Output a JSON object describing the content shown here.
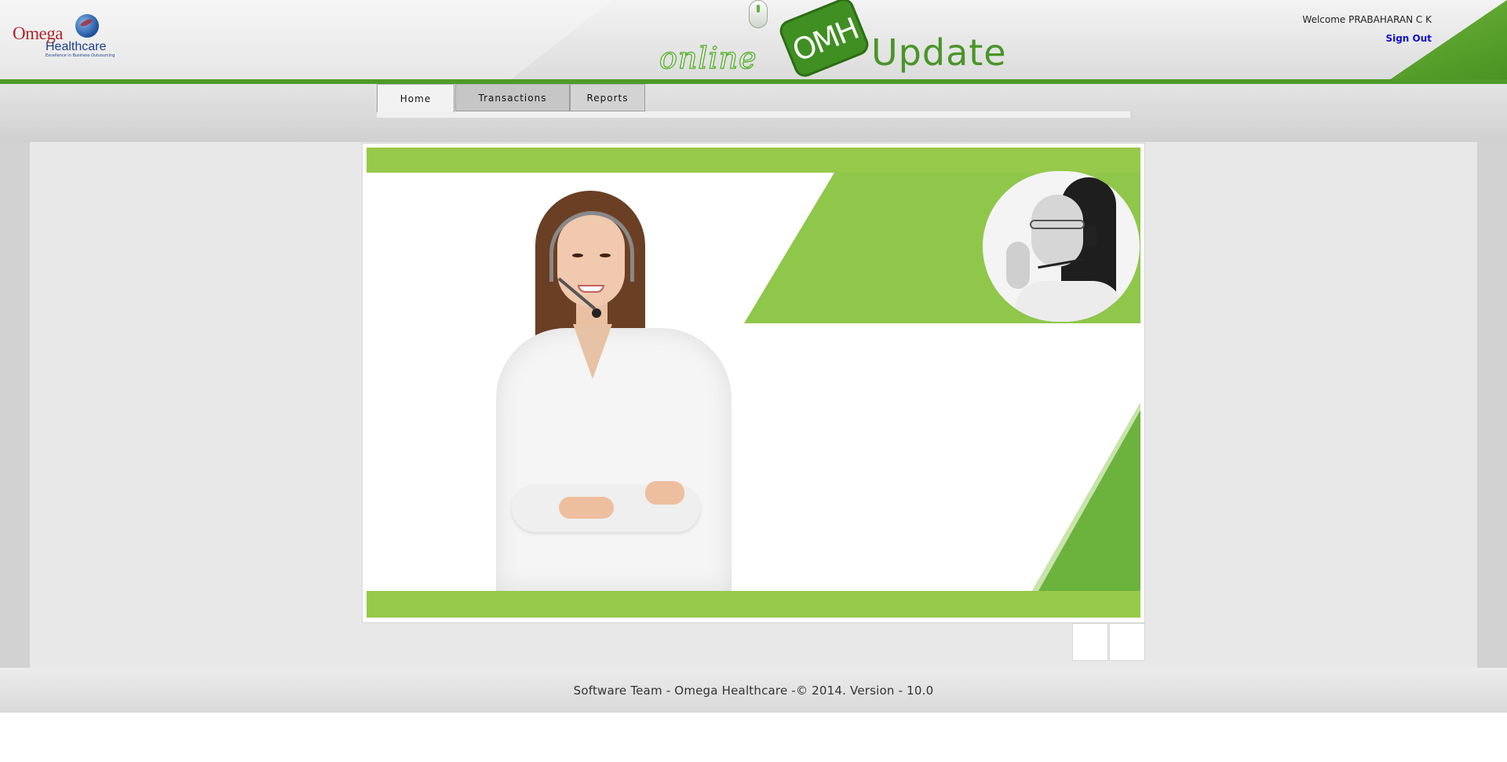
{
  "header": {
    "logo": {
      "word1": "Omega",
      "word2": "Healthcare",
      "tagline": "Excellence in Business Outsourcing"
    },
    "brand": {
      "online": "online",
      "badge": "OMH",
      "update": "Update"
    },
    "welcome": "Welcome PRABAHARAN C K",
    "sign_out": "Sign Out"
  },
  "nav": {
    "tabs": [
      {
        "label": "Home",
        "active": true
      },
      {
        "label": "Transactions",
        "active": false
      },
      {
        "label": "Reports",
        "active": false
      }
    ]
  },
  "banner": {
    "icons": [
      "headset-agent-photo",
      "headset-agent-circle-photo"
    ],
    "colors": {
      "light_green": "#97c94b",
      "dark_green": "#6bb33d",
      "header_stripe": "#4f9a2a"
    }
  },
  "footer": {
    "text": "Software Team - Omega Healthcare -© 2014. Version - 10.0"
  }
}
